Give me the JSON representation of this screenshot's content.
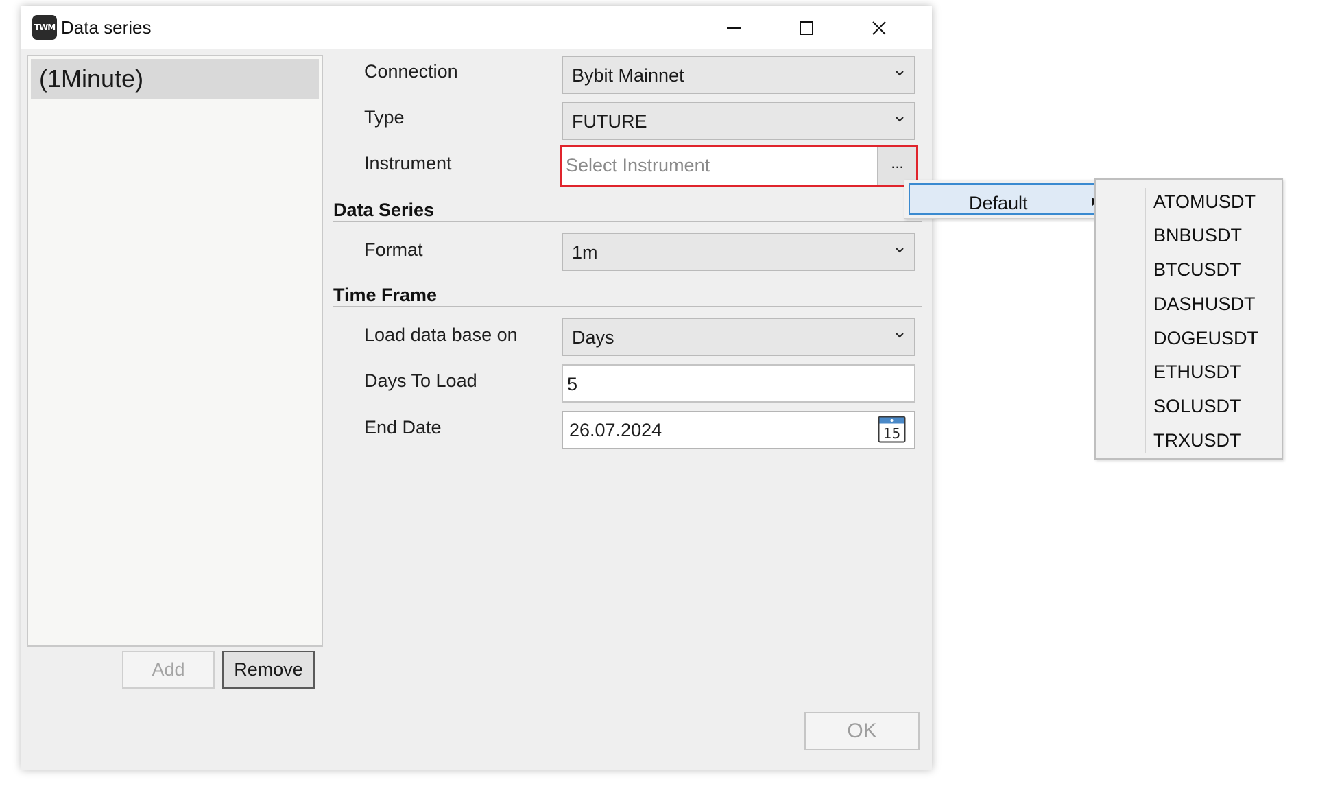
{
  "window": {
    "title": "Data series",
    "app_icon_text": "TWM"
  },
  "series_list": {
    "items": [
      "(1Minute)"
    ]
  },
  "buttons": {
    "add": "Add",
    "remove": "Remove",
    "ok": "OK"
  },
  "fields": {
    "connection": {
      "label": "Connection",
      "value": "Bybit Mainnet"
    },
    "type": {
      "label": "Type",
      "value": "FUTURE"
    },
    "instrument": {
      "label": "Instrument",
      "placeholder": "Select Instrument",
      "browse_label": "..."
    },
    "format": {
      "label": "Format",
      "value": "1m"
    },
    "load_base": {
      "label": "Load data base on",
      "value": "Days"
    },
    "days_to_load": {
      "label": "Days To Load",
      "value": "5"
    },
    "end_date": {
      "label": "End Date",
      "value": "26.07.2024",
      "calendar_day": "15"
    }
  },
  "sections": {
    "data_series": "Data Series",
    "time_frame": "Time Frame"
  },
  "context_menu": {
    "level1": {
      "label": "Default"
    },
    "level2": {
      "items": [
        "ATOMUSDT",
        "BNBUSDT",
        "BTCUSDT",
        "DASHUSDT",
        "DOGEUSDT",
        "ETHUSDT",
        "SOLUSDT",
        "TRXUSDT"
      ]
    }
  },
  "colors": {
    "error_border": "#e0242c",
    "menu_highlight": "#dfeaf6",
    "menu_highlight_border": "#3a8ad0",
    "calendar_blue": "#4a89c8"
  },
  "icons": [
    "app-icon",
    "minimize-icon",
    "maximize-icon",
    "close-icon",
    "chevron-down-icon",
    "calendar-icon",
    "submenu-arrow-icon"
  ]
}
